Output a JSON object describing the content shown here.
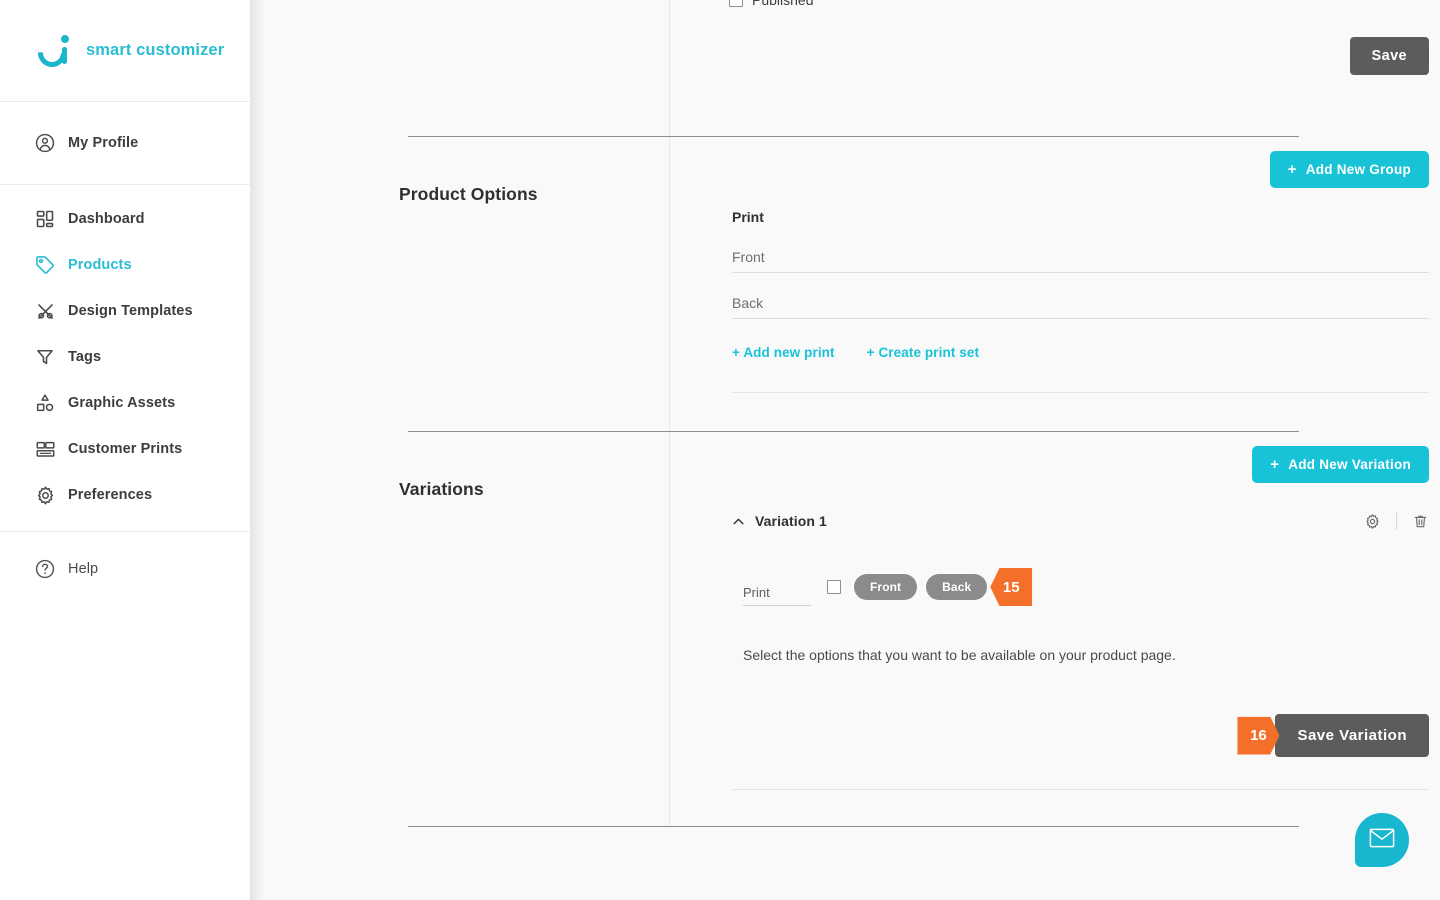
{
  "brand": {
    "name": "smart customizer",
    "logo_icon": "circle-dot-logo-icon",
    "accent_color": "#2bbdd2"
  },
  "sidebar": {
    "profile": {
      "label": "My Profile",
      "icon": "user-circle-icon"
    },
    "items": [
      {
        "label": "Dashboard",
        "icon": "dashboard-grid-icon",
        "active": false
      },
      {
        "label": "Products",
        "icon": "tag-icon",
        "active": true
      },
      {
        "label": "Design Templates",
        "icon": "scissors-icon",
        "active": false
      },
      {
        "label": "Tags",
        "icon": "funnel-icon",
        "active": false
      },
      {
        "label": "Graphic Assets",
        "icon": "shapes-icon",
        "active": false
      },
      {
        "label": "Customer Prints",
        "icon": "prints-stack-icon",
        "active": false
      },
      {
        "label": "Preferences",
        "icon": "gear-icon",
        "active": false
      }
    ],
    "help": {
      "label": "Help",
      "icon": "question-circle-icon"
    }
  },
  "top_section": {
    "published_label": "Published",
    "published_checked": false,
    "save_label": "Save"
  },
  "product_options": {
    "title": "Product Options",
    "add_group_label": "Add New Group",
    "add_group_plus": "+",
    "group_name": "Print",
    "prints": [
      "Front",
      "Back"
    ],
    "links": [
      {
        "label": "+ Add new print"
      },
      {
        "label": "+ Create print set"
      }
    ]
  },
  "variations": {
    "title": "Variations",
    "add_variation_label": "Add New Variation",
    "add_variation_plus": "+",
    "variation": {
      "name": "Variation 1",
      "collapse_icon": "chevron-up-icon",
      "settings_icon": "gear-icon",
      "delete_icon": "trash-icon",
      "option_label": "Print",
      "option_checked": false,
      "pills": [
        "Front",
        "Back"
      ],
      "badge_options": "15",
      "hint": "Select the options that you want to be available on your product page.",
      "badge_save": "16",
      "save_label": "Save Variation"
    }
  },
  "chat_widget": {
    "icon": "envelope-icon",
    "color": "#18b6cf"
  }
}
